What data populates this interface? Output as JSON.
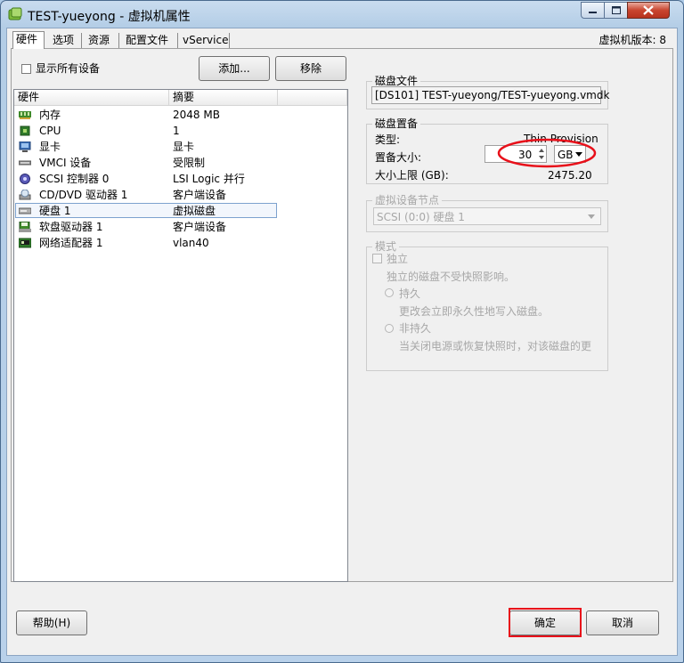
{
  "window": {
    "title": "TEST-yueyong - 虚拟机属性"
  },
  "tabs": [
    "硬件",
    "选项",
    "资源",
    "配置文件",
    "vService"
  ],
  "version_label": "虚拟机版本: 8",
  "show_all": {
    "label": "显示所有设备",
    "checked": false
  },
  "buttons": {
    "add": "添加...",
    "remove": "移除",
    "help": "帮助(H)",
    "ok": "确定",
    "cancel": "取消"
  },
  "hardware_list": {
    "col_hardware": "硬件",
    "col_summary": "摘要",
    "rows": [
      {
        "name": "内存",
        "summary": "2048 MB",
        "icon": "memory-icon"
      },
      {
        "name": "CPU",
        "summary": "1",
        "icon": "cpu-icon"
      },
      {
        "name": "显卡",
        "summary": "显卡",
        "icon": "video-card-icon"
      },
      {
        "name": "VMCI 设备",
        "summary": "受限制",
        "icon": "vmci-icon"
      },
      {
        "name": "SCSI 控制器 0",
        "summary": "LSI Logic 并行",
        "icon": "scsi-icon"
      },
      {
        "name": "CD/DVD 驱动器 1",
        "summary": "客户端设备",
        "icon": "cdrom-icon"
      },
      {
        "name": "硬盘 1",
        "summary": "虚拟磁盘",
        "icon": "hard-disk-icon"
      },
      {
        "name": "软盘驱动器 1",
        "summary": "客户端设备",
        "icon": "floppy-icon"
      },
      {
        "name": "网络适配器 1",
        "summary": "vlan40",
        "icon": "network-icon"
      }
    ],
    "selected_index": 6
  },
  "disk_file": {
    "legend": "磁盘文件",
    "value": "[DS101] TEST-yueyong/TEST-yueyong.vmdk"
  },
  "provisioning": {
    "legend": "磁盘置备",
    "type_label": "类型:",
    "type_value": "Thin Provision",
    "size_label": "置备大小:",
    "size_value": "30",
    "unit": "GB",
    "max_label": "大小上限 (GB):",
    "max_value": "2475.20"
  },
  "vdev_node": {
    "legend": "虚拟设备节点",
    "value": "SCSI (0:0) 硬盘 1"
  },
  "mode": {
    "legend": "模式",
    "independent_label": "独立",
    "independent_desc": "独立的磁盘不受快照影响。",
    "persistent_label": "持久",
    "persistent_desc": "更改会立即永久性地写入磁盘。",
    "nonpersistent_label": "非持久",
    "nonpersistent_desc": "当关闭电源或恢复快照时，对该磁盘的更"
  },
  "colors": {
    "highlight_red": "#e8101a",
    "selection": "#7da2ce"
  }
}
